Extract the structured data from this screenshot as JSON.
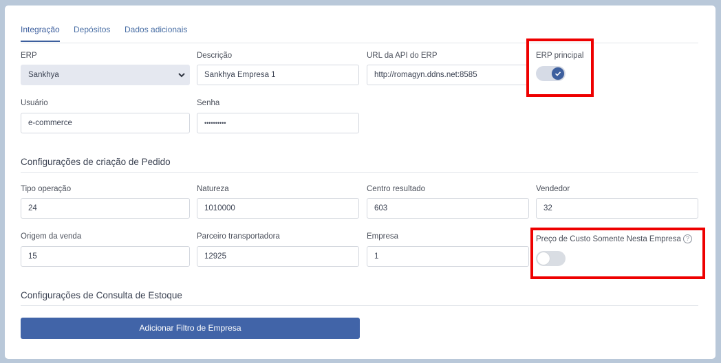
{
  "tabs": [
    {
      "label": "Integração",
      "active": true
    },
    {
      "label": "Depósitos",
      "active": false
    },
    {
      "label": "Dados adicionais",
      "active": false
    }
  ],
  "erp_section": {
    "erp": {
      "label": "ERP",
      "value": "Sankhya"
    },
    "descricao": {
      "label": "Descrição",
      "value": "Sankhya Empresa 1"
    },
    "url_api": {
      "label": "URL da API do ERP",
      "value": "http://romagyn.ddns.net:8585"
    },
    "erp_principal": {
      "label": "ERP principal",
      "checked": true
    },
    "usuario": {
      "label": "Usuário",
      "value": "e-commerce"
    },
    "senha": {
      "label": "Senha",
      "value": "••••••••••"
    }
  },
  "pedido_section": {
    "title": "Configurações de criação de Pedido",
    "tipo_operacao": {
      "label": "Tipo operação",
      "value": "24"
    },
    "natureza": {
      "label": "Natureza",
      "value": "1010000"
    },
    "centro_resultado": {
      "label": "Centro resultado",
      "value": "603"
    },
    "vendedor": {
      "label": "Vendedor",
      "value": "32"
    },
    "origem_venda": {
      "label": "Origem da venda",
      "value": "15"
    },
    "parceiro_transportadora": {
      "label": "Parceiro transportadora",
      "value": "12925"
    },
    "empresa": {
      "label": "Empresa",
      "value": "1"
    },
    "preco_custo": {
      "label": "Preço de Custo Somente Nesta Empresa",
      "help": "?",
      "checked": false
    }
  },
  "estoque_section": {
    "title": "Configurações de Consulta de Estoque",
    "add_filter_button": "Adicionar Filtro de Empresa"
  },
  "colors": {
    "accent": "#3d5f9e",
    "button": "#4164a8",
    "highlight": "#ee0000"
  }
}
